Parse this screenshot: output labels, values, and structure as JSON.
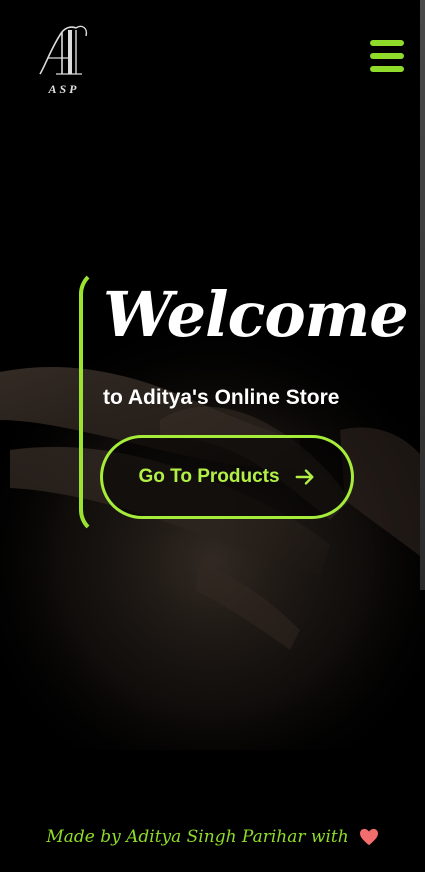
{
  "header": {
    "logo_text": "ASP",
    "menu_icon": "hamburger-menu-icon"
  },
  "hero": {
    "title": "Welcome",
    "subtitle": "to Aditya's Online Store",
    "cta_label": "Go To Products",
    "cta_icon": "arrow-right-icon"
  },
  "footer": {
    "text": "Made by Aditya Singh Parihar with",
    "icon": "heart-icon"
  },
  "colors": {
    "accent": "#8fdc2a",
    "cta_border": "#a6ec3a",
    "heart": "#f26d6d",
    "background": "#000000",
    "text": "#ffffff"
  }
}
